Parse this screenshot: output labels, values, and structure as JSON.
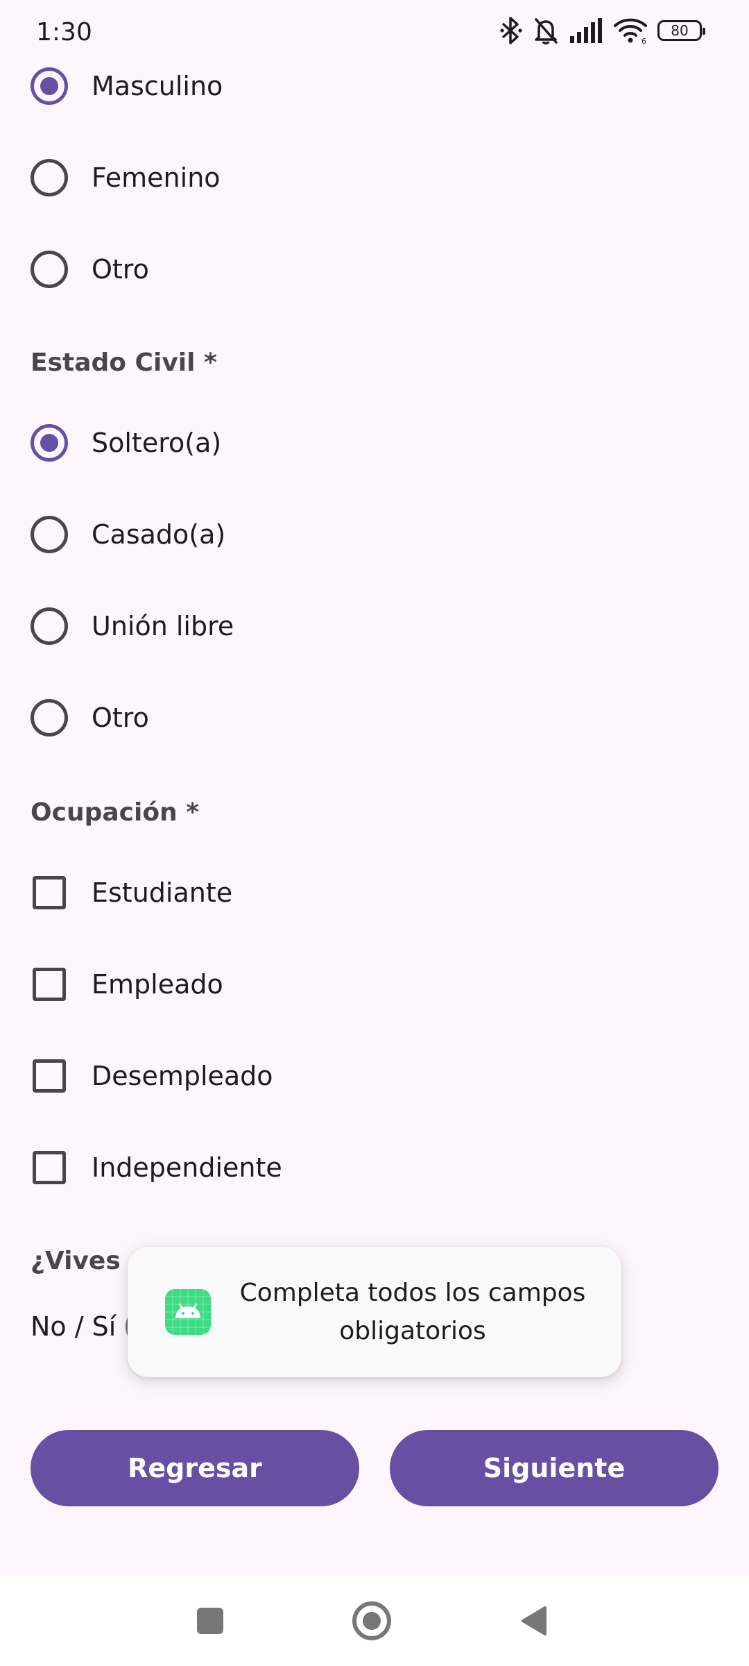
{
  "status_bar": {
    "time": "1:30",
    "battery_level": "80",
    "icons": [
      "bluetooth-icon",
      "bell-off-icon",
      "signal-icon",
      "wifi-icon",
      "battery-icon"
    ]
  },
  "gender": {
    "options": [
      {
        "label": "Masculino",
        "checked": true
      },
      {
        "label": "Femenino",
        "checked": false
      },
      {
        "label": "Otro",
        "checked": false
      }
    ]
  },
  "marital_status": {
    "title": "Estado Civil *",
    "options": [
      {
        "label": "Soltero(a)",
        "checked": true
      },
      {
        "label": "Casado(a)",
        "checked": false
      },
      {
        "label": "Unión libre",
        "checked": false
      },
      {
        "label": "Otro",
        "checked": false
      }
    ]
  },
  "occupation": {
    "title": "Ocupación *",
    "options": [
      {
        "label": "Estudiante",
        "checked": false
      },
      {
        "label": "Empleado",
        "checked": false
      },
      {
        "label": "Desempleado",
        "checked": false
      },
      {
        "label": "Independiente",
        "checked": false
      }
    ]
  },
  "lives_with": {
    "title_visible": "¿Vives c",
    "switch_label": "No / Sí",
    "switch_on": false
  },
  "buttons": {
    "back_label": "Regresar",
    "next_label": "Siguiente"
  },
  "toast": {
    "message": "Completa todos los campos obligatorios",
    "icon": "android-app-icon"
  },
  "nav_bar": {
    "icons": [
      "recents-icon",
      "home-icon",
      "back-icon"
    ]
  },
  "colors": {
    "accent": "#6750A4",
    "background": "#FDF7FD",
    "android_green": "#3DDC84"
  }
}
